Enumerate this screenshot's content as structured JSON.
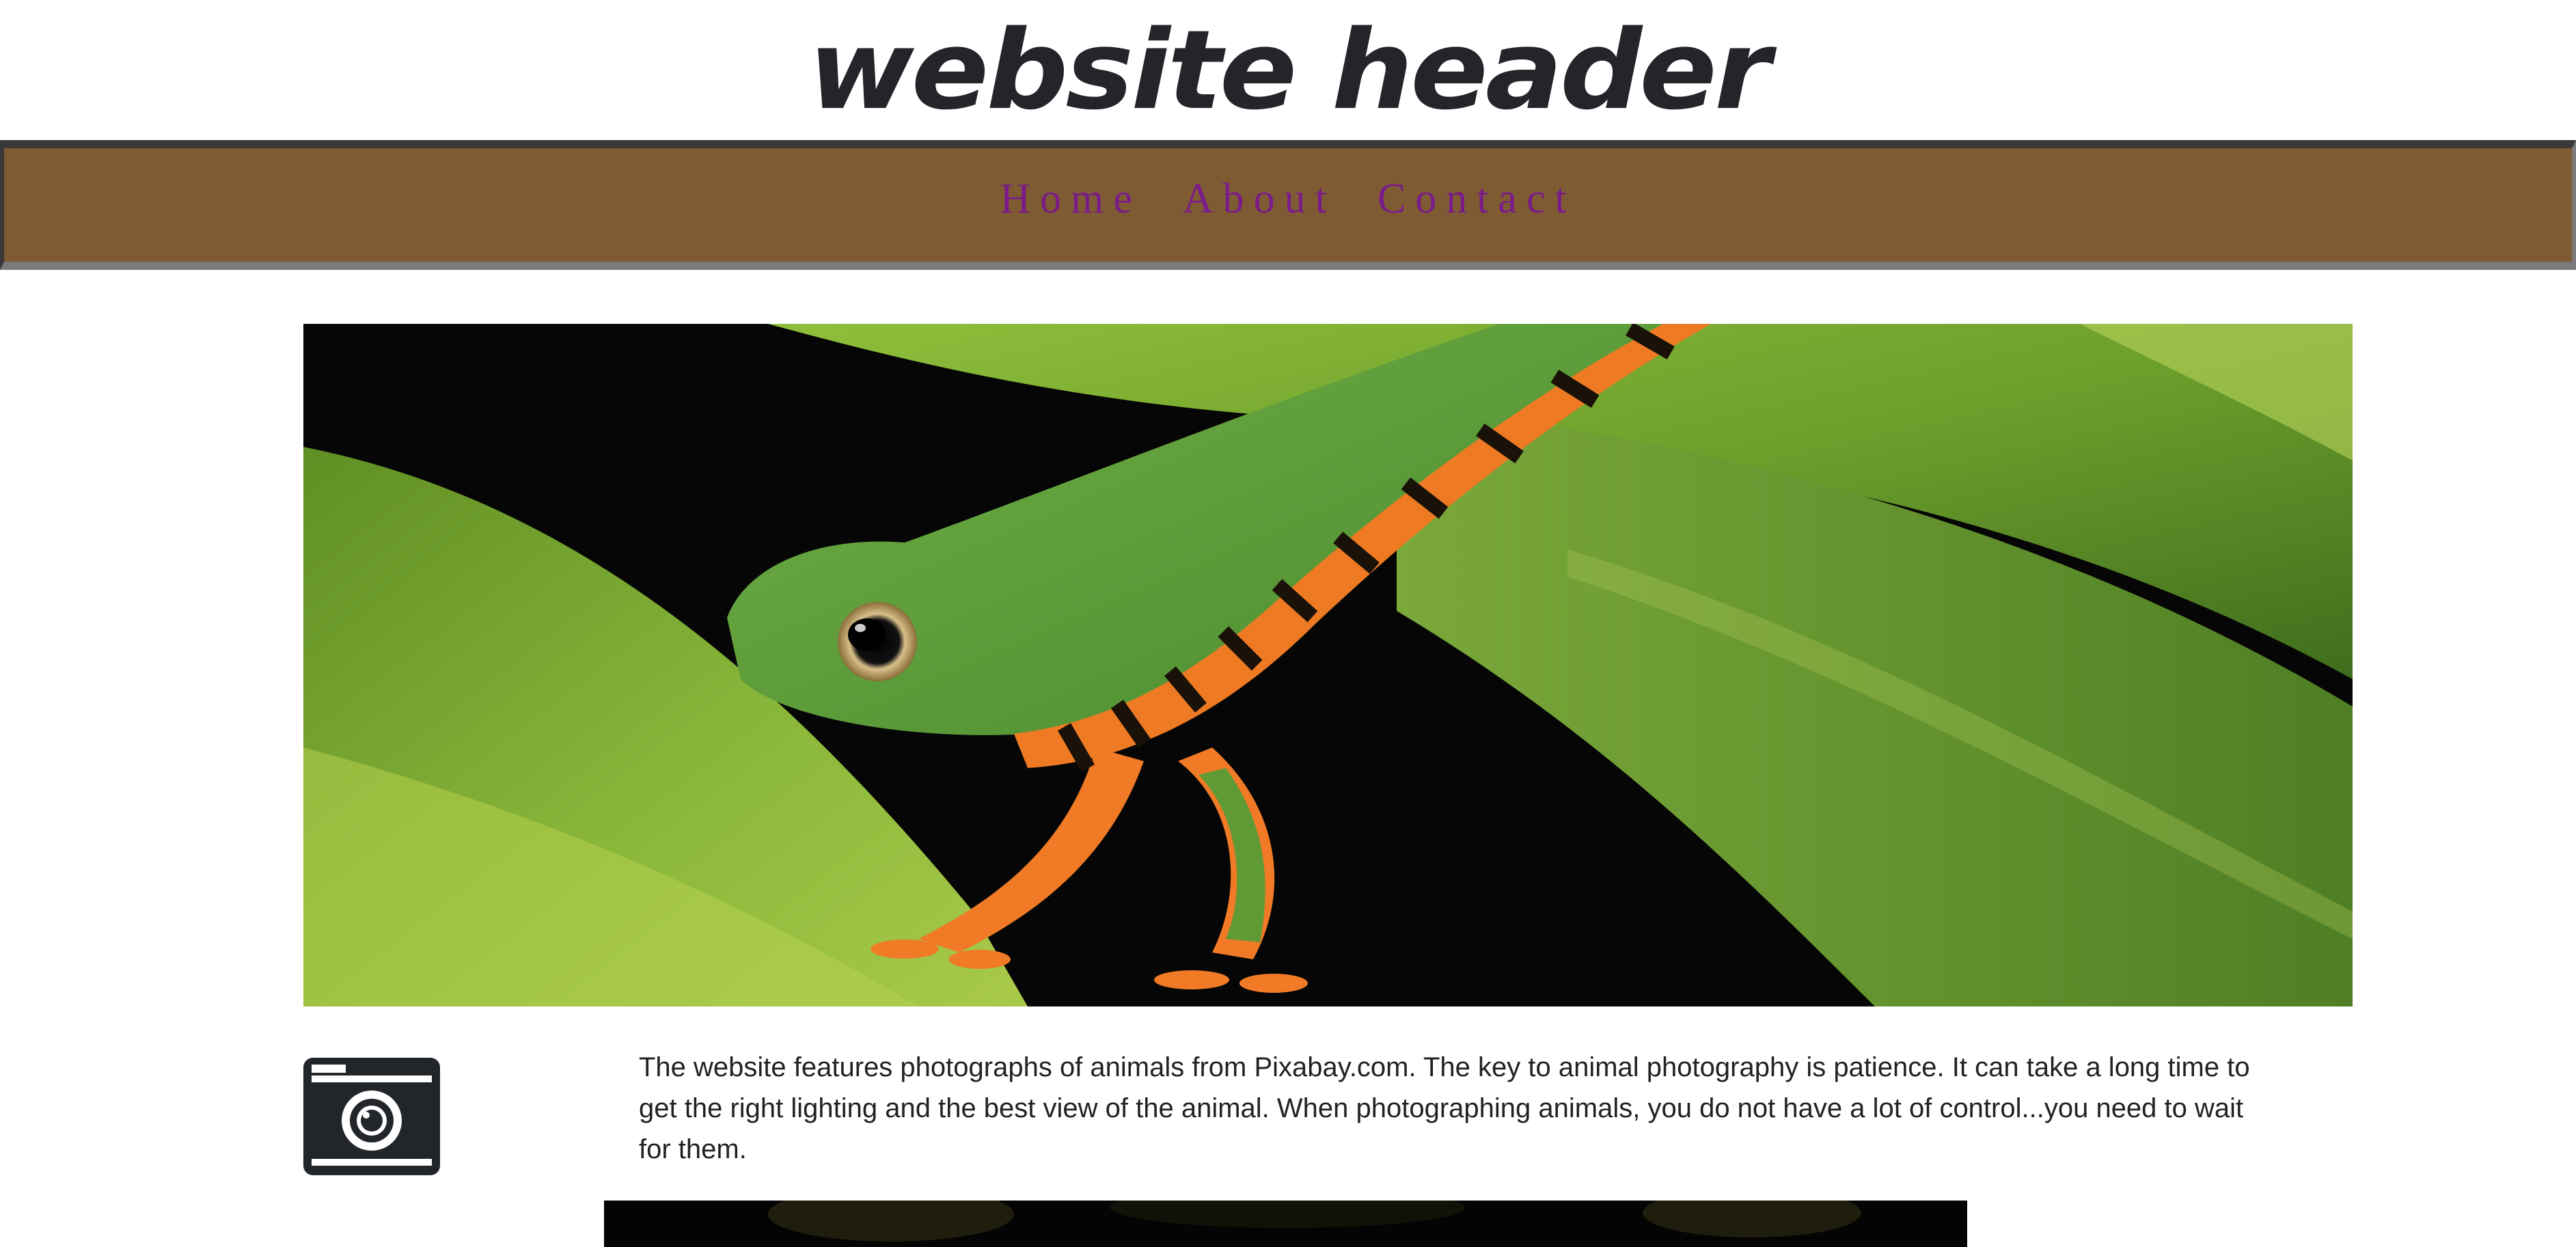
{
  "header": {
    "title": "website header"
  },
  "nav": {
    "items": [
      {
        "label": "Home"
      },
      {
        "label": "About"
      },
      {
        "label": "Contact"
      }
    ]
  },
  "hero": {
    "icon": "tree-frog-photo"
  },
  "content": {
    "icon": "camera-icon",
    "intro": "The website features photographs of animals from Pixabay.com. The key to animal photography is patience. It can take a long time to get the right lighting and the best view of the animal. When photographing animals, you do not have a lot of control...you need to wait for them."
  },
  "second_image": {
    "icon": "animal-photo"
  },
  "colors": {
    "nav_background": "#7e5b33",
    "nav_link": "#7b1b8a",
    "title": "#23252a",
    "body_text": "#222222"
  }
}
